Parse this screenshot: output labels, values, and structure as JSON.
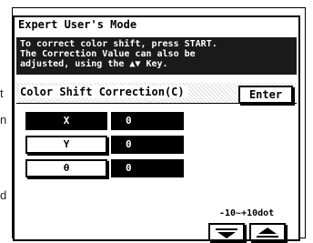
{
  "outside_text": [
    "t",
    "n",
    "d"
  ],
  "title": "Expert User's Mode",
  "message": [
    "To correct color shift, press START.",
    "The Correction Value can also be",
    "adjusted, using the ▲▼ Key."
  ],
  "section_label": "Color Shift Correction(C)",
  "enter_label": "Enter",
  "rows": [
    {
      "key": "X",
      "value": "0"
    },
    {
      "key": "Y",
      "value": "0"
    },
    {
      "key": "θ",
      "value": "0"
    }
  ],
  "range_label": "-10~+10dot",
  "icons": {
    "down": "triangle-down-icon",
    "up": "triangle-up-icon"
  }
}
